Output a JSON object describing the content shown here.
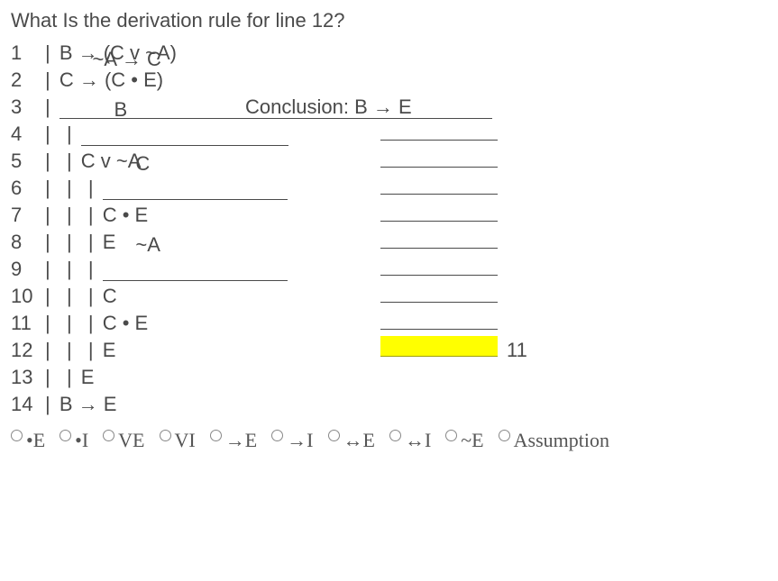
{
  "question": "What Is the derivation rule for line 12?",
  "conclusion_label": "Conclusion: B → E",
  "proof": {
    "l1": {
      "n": "1",
      "bars": "| ",
      "f": "B → (C v ~A)"
    },
    "l2": {
      "n": "2",
      "bars": "| ",
      "f": "C → (C • E)"
    },
    "l3": {
      "n": "3",
      "bars": "| ",
      "f": "~A → C"
    },
    "l4": {
      "n": "4",
      "bars": "|  | ",
      "f": "B"
    },
    "l5": {
      "n": "5",
      "bars": "|  | ",
      "f": "C v ~A"
    },
    "l6": {
      "n": "6",
      "bars": "|  |  | ",
      "f": "C"
    },
    "l7": {
      "n": "7",
      "bars": "|  |  | ",
      "f": "C • E"
    },
    "l8": {
      "n": "8",
      "bars": "|  |  | ",
      "f": "E"
    },
    "l9": {
      "n": "9",
      "bars": "|  |  | ",
      "f": "~A"
    },
    "l10": {
      "n": "10",
      "bars": "|  |  | ",
      "f": "C"
    },
    "l11": {
      "n": "11",
      "bars": "|  |  | ",
      "f": "C • E"
    },
    "l12": {
      "n": "12",
      "bars": "|  |  | ",
      "f": "E",
      "cite": "11"
    },
    "l13": {
      "n": "13",
      "bars": "|  | ",
      "f": "E"
    },
    "l14": {
      "n": "14",
      "bars": "| ",
      "f": "B → E"
    }
  },
  "options": {
    "o1": "•E",
    "o2": "•I",
    "o3": "VE",
    "o4": "VI",
    "o5": "→E",
    "o6": "→I",
    "o7": "↔E",
    "o8": "↔I",
    "o9": "~E",
    "o10": "Assumption"
  }
}
